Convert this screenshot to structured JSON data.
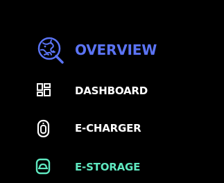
{
  "nav": {
    "items": [
      {
        "label": "OVERVIEW",
        "icon": "globe-search-icon",
        "color": "#5b74f5"
      },
      {
        "label": "DASHBOARD",
        "icon": "dashboard-grid-icon",
        "color": "#ffffff"
      },
      {
        "label": "E-CHARGER",
        "icon": "charger-icon",
        "color": "#ffffff"
      },
      {
        "label": "E-STORAGE",
        "icon": "storage-icon",
        "color": "#5fe8c0"
      }
    ]
  }
}
